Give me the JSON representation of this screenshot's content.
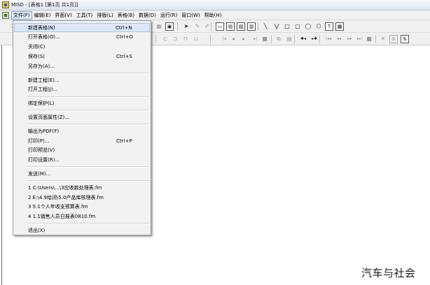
{
  "window": {
    "title": "MISD - [表格1 [第1页 共1页]]"
  },
  "menubar": {
    "items": [
      "文件(F)",
      "编辑(E)",
      "界面(V)",
      "工具(T)",
      "排版(L)",
      "表格(B)",
      "数据(D)",
      "运行(R)",
      "窗口(W)",
      "帮助(H)"
    ]
  },
  "file_menu": {
    "groups": [
      [
        {
          "label": "新建表格(N)",
          "shortcut": "Ctrl+N"
        },
        {
          "label": "打开表格(O)...",
          "shortcut": "Ctrl+O"
        },
        {
          "label": "关闭(C)",
          "shortcut": ""
        },
        {
          "label": "保存(S)",
          "shortcut": "Ctrl+S"
        },
        {
          "label": "另存为(A)...",
          "shortcut": ""
        }
      ],
      [
        {
          "label": "新建工程(E)...",
          "shortcut": ""
        },
        {
          "label": "打开工程(J)...",
          "shortcut": ""
        }
      ],
      [
        {
          "label": "绑定保护(L)",
          "shortcut": ""
        }
      ],
      [
        {
          "label": "设置页面属性(Z)...",
          "shortcut": ""
        }
      ],
      [
        {
          "label": "输出为PDF(F)",
          "shortcut": ""
        },
        {
          "label": "打印(P)...",
          "shortcut": "Ctrl+P"
        },
        {
          "label": "打印预览(V)",
          "shortcut": ""
        },
        {
          "label": "打印设置(R)...",
          "shortcut": ""
        }
      ],
      [
        {
          "label": "发送(M)...",
          "shortcut": ""
        }
      ],
      [
        {
          "label": "1 C:\\Users\\...\\3应收款处理表.fm",
          "shortcut": ""
        },
        {
          "label": "2 E:\\4.9给闭\\5.0产品库核理表.fm",
          "shortcut": ""
        },
        {
          "label": "3 5.1个人年收支预算表.fm",
          "shortcut": ""
        },
        {
          "label": "4 1.1销售人员日报表0810.fm",
          "shortcut": ""
        }
      ],
      [
        {
          "label": "退出(X)",
          "shortcut": ""
        }
      ]
    ]
  },
  "toolbar": {
    "row1": [
      {
        "name": "new-file-icon",
        "glyph": "🗋",
        "boxed": false,
        "grey": false
      },
      {
        "name": "insert-table-icon",
        "glyph": "▦",
        "boxed": false,
        "grey": true
      },
      {
        "name": "insert-image-icon",
        "glyph": "▣",
        "boxed": true,
        "grey": false
      },
      {
        "name": "select-pointer-icon",
        "glyph": "➤",
        "boxed": false,
        "grey": false
      },
      {
        "name": "pen-icon",
        "glyph": "✎",
        "boxed": false,
        "grey": true
      },
      {
        "name": "eraser-icon",
        "glyph": "✐",
        "boxed": false,
        "grey": true
      },
      {
        "name": "text-box-icon",
        "glyph": "▭",
        "boxed": true,
        "grey": false
      },
      {
        "name": "label-icon",
        "glyph": "▤",
        "boxed": true,
        "grey": false
      },
      {
        "name": "field-icon",
        "glyph": "▧",
        "boxed": true,
        "grey": false
      },
      {
        "name": "grid-field-icon",
        "glyph": "▥",
        "boxed": true,
        "grey": false
      },
      {
        "name": "line-icon",
        "glyph": "╲",
        "boxed": false,
        "grey": false
      },
      {
        "name": "polyline-icon",
        "glyph": "⋁",
        "boxed": false,
        "grey": false
      },
      {
        "name": "rectangle-icon",
        "glyph": "□",
        "boxed": false,
        "grey": false
      },
      {
        "name": "rounded-rectangle-icon",
        "glyph": "▢",
        "boxed": false,
        "grey": false
      },
      {
        "name": "ellipse-icon",
        "glyph": "◯",
        "boxed": false,
        "grey": false
      },
      {
        "name": "polygon-icon",
        "glyph": "⬡",
        "boxed": false,
        "grey": false
      },
      {
        "name": "text-icon",
        "glyph": "T",
        "boxed": true,
        "grey": false
      },
      {
        "name": "barcode-icon",
        "glyph": "▩",
        "boxed": true,
        "grey": false
      }
    ],
    "row2": [
      {
        "name": "align-left-icon",
        "glyph": "⊏",
        "boxed": false,
        "grey": true
      },
      {
        "name": "align-center-icon",
        "glyph": "⊐",
        "boxed": false,
        "grey": true
      },
      {
        "name": "align-right-icon",
        "glyph": "⊓",
        "boxed": false,
        "grey": true
      },
      {
        "name": "distribute-icon",
        "glyph": "⊔",
        "boxed": false,
        "grey": true
      },
      {
        "name": "first-record-icon",
        "glyph": "|◂",
        "boxed": false,
        "grey": true
      },
      {
        "name": "prev-record-icon",
        "glyph": "◂",
        "boxed": false,
        "grey": true
      },
      {
        "name": "next-record-icon",
        "glyph": "▸",
        "boxed": false,
        "grey": true
      },
      {
        "name": "last-record-icon",
        "glyph": "▸|",
        "boxed": false,
        "grey": true
      },
      {
        "name": "stop-record-icon",
        "glyph": "■",
        "boxed": false,
        "grey": true
      },
      {
        "name": "copy-record-icon",
        "glyph": "⧉",
        "boxed": false,
        "grey": true
      },
      {
        "name": "paste-record-icon",
        "glyph": "▤",
        "boxed": false,
        "grey": true
      },
      {
        "name": "insert-row-before-icon",
        "glyph": "✱◂",
        "boxed": false,
        "grey": false
      },
      {
        "name": "insert-row-after-icon",
        "glyph": "▸✱",
        "boxed": false,
        "grey": false
      },
      {
        "name": "page-first-icon",
        "glyph": "|◂◂",
        "boxed": false,
        "grey": true
      },
      {
        "name": "page-prev-icon",
        "glyph": "◂◂",
        "boxed": false,
        "grey": true
      },
      {
        "name": "page-next-icon",
        "glyph": "▸▸",
        "boxed": false,
        "grey": true
      },
      {
        "name": "page-last-icon",
        "glyph": "▸▸|",
        "boxed": false,
        "grey": true
      },
      {
        "name": "save-record-icon",
        "glyph": "■",
        "boxed": false,
        "grey": true
      },
      {
        "name": "delete-record-icon",
        "glyph": "✕",
        "boxed": false,
        "grey": true
      },
      {
        "name": "sort-icon",
        "glyph": "⊞",
        "boxed": true,
        "grey": true
      },
      {
        "name": "sort-az-icon",
        "glyph": "⇅",
        "boxed": true,
        "grey": false
      }
    ]
  }
}
